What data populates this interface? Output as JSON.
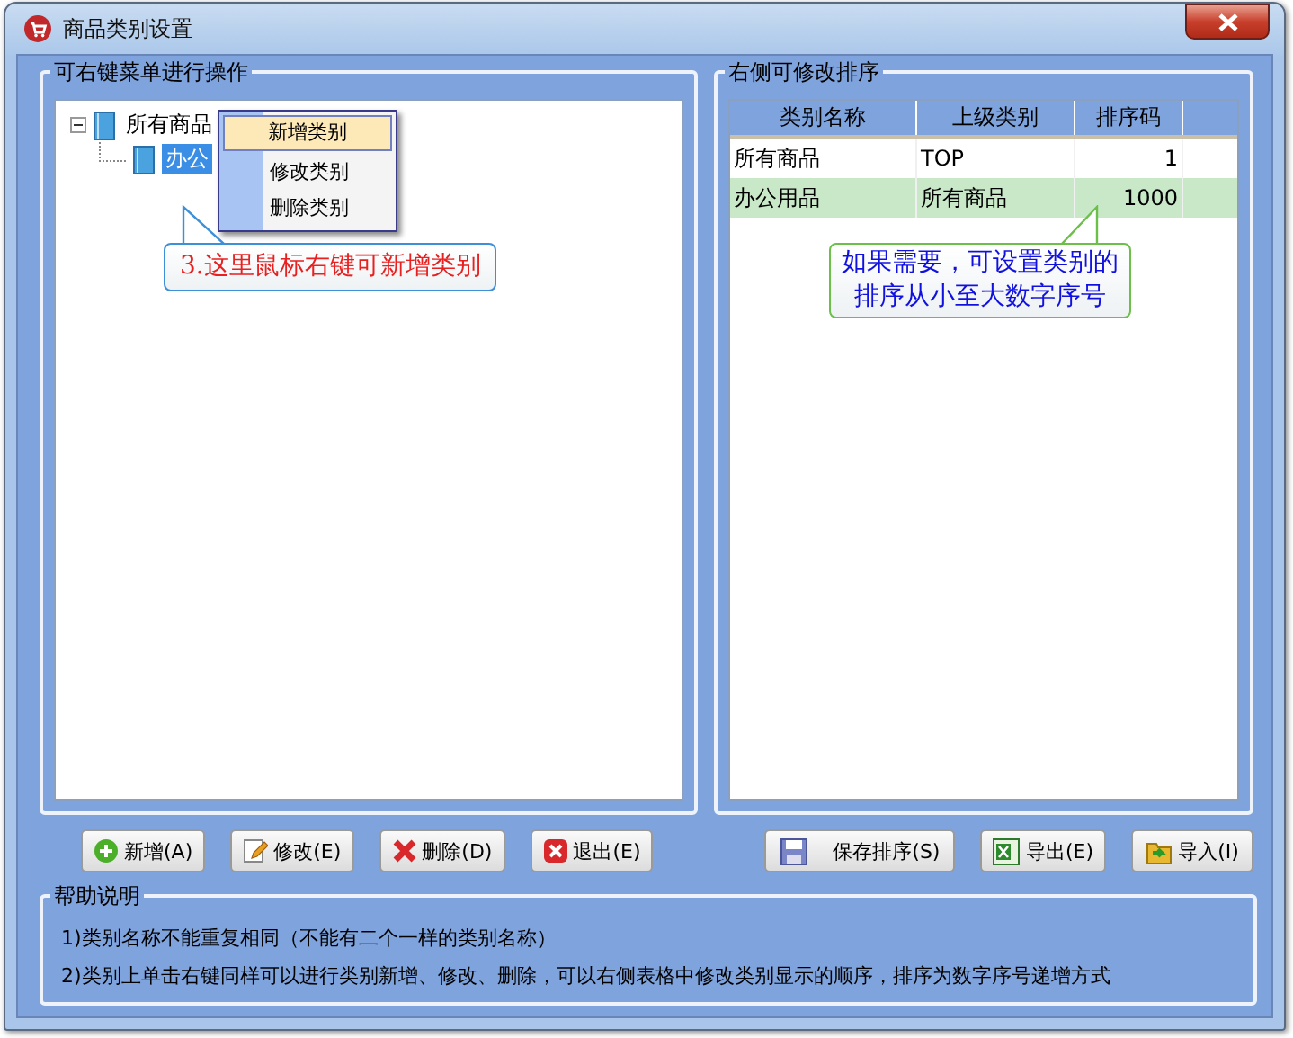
{
  "window": {
    "title": "商品类别设置"
  },
  "tree_panel": {
    "title": "可右键菜单进行操作",
    "tree": [
      {
        "label": "所有商品",
        "expanded": true,
        "selected": false,
        "children": [
          {
            "label": "办公",
            "selected": true
          }
        ]
      }
    ]
  },
  "context_menu": {
    "items": [
      {
        "label": "新增类别",
        "selected": true
      },
      {
        "label": "修改类别",
        "selected": false
      },
      {
        "label": "删除类别",
        "selected": false
      }
    ]
  },
  "tree_callout": "3.这里鼠标右键可新增类别",
  "sort_panel": {
    "title": "右侧可修改排序",
    "columns": [
      "类别名称",
      "上级类别",
      "排序码"
    ],
    "rows": [
      {
        "cells": [
          "所有商品",
          "TOP",
          "1"
        ],
        "selected": false
      },
      {
        "cells": [
          "办公用品",
          "所有商品",
          "1000"
        ],
        "selected": true
      }
    ]
  },
  "table_callout": [
    "如果需要，可设置类别的",
    "排序从小至大数字序号"
  ],
  "left_buttons": [
    {
      "label": "新增(A)",
      "kind": "plus"
    },
    {
      "label": "修改(E)",
      "kind": "edit"
    },
    {
      "label": "删除(D)",
      "kind": "delete"
    },
    {
      "label": "退出(E)",
      "kind": "exit"
    }
  ],
  "right_buttons": [
    {
      "label": "保存排序(S)",
      "kind": "save"
    },
    {
      "label": "导出(E)",
      "kind": "excel"
    },
    {
      "label": "导入(I)",
      "kind": "import"
    }
  ],
  "help": {
    "title": "帮助说明",
    "lines": [
      "1)类别名称不能重复相同（不能有二个一样的类别名称）",
      "2)类别上单击右键同样可以进行类别新增、修改、删除，可以右侧表格中修改类别显示的顺序，排序为数字序号递增方式"
    ]
  }
}
